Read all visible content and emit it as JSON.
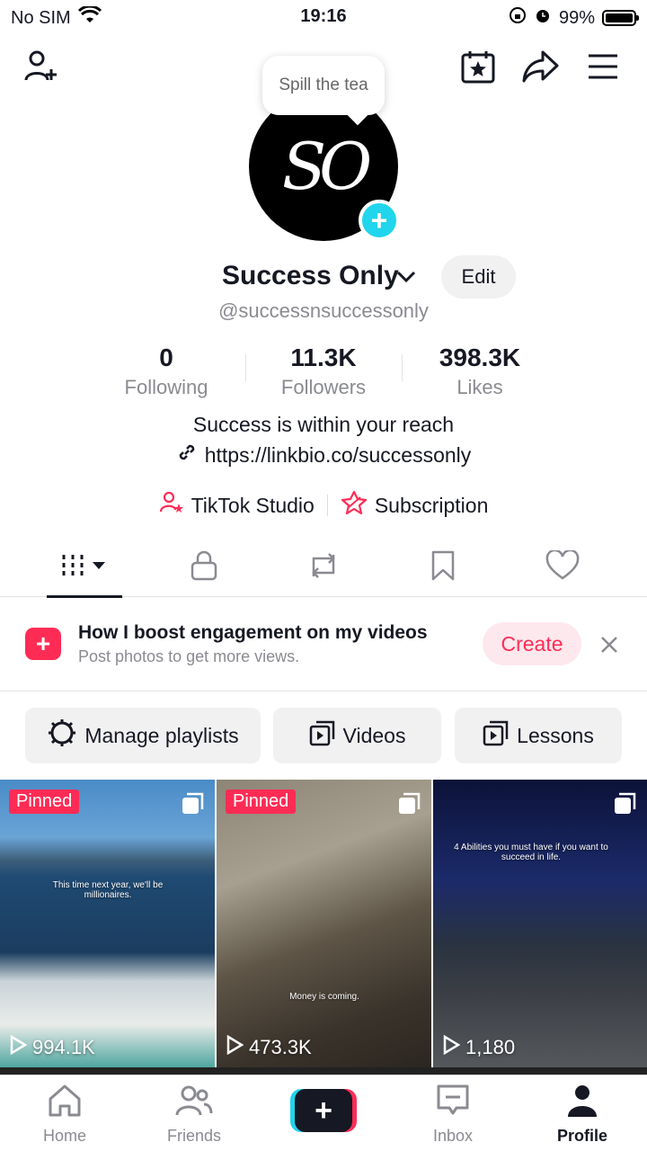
{
  "status_bar": {
    "carrier": "No SIM",
    "time": "19:16",
    "battery": "99%"
  },
  "tooltip": "Spill the tea",
  "profile": {
    "name": "Success Only",
    "handle": "@successnsuccessonly",
    "edit_label": "Edit",
    "bio": "Success is within your reach",
    "link": "https://linkbio.co/successonly"
  },
  "stats": [
    {
      "value": "0",
      "label": "Following"
    },
    {
      "value": "11.3K",
      "label": "Followers"
    },
    {
      "value": "398.3K",
      "label": "Likes"
    }
  ],
  "tools": {
    "studio": "TikTok Studio",
    "subscription": "Subscription"
  },
  "banner": {
    "title": "How I boost engagement on my videos",
    "subtitle": "Post photos to get more views.",
    "create_label": "Create"
  },
  "chips": {
    "manage": "Manage playlists",
    "videos": "Videos",
    "lessons": "Lessons"
  },
  "posts": [
    {
      "pinned": "Pinned",
      "caption": "This time next year, we'll be millionaires.",
      "views": "994.1K"
    },
    {
      "pinned": "Pinned",
      "caption": "Money is coming.",
      "views": "473.3K"
    },
    {
      "caption": "4 Abilities you must have if you want to succeed in life.",
      "views": "1,180"
    }
  ],
  "bottom_nav": {
    "home": "Home",
    "friends": "Friends",
    "inbox": "Inbox",
    "profile": "Profile"
  },
  "colors": {
    "accent": "#fe2c55",
    "cyan": "#20d5ec",
    "text": "#161823",
    "muted": "#8a8b91"
  }
}
